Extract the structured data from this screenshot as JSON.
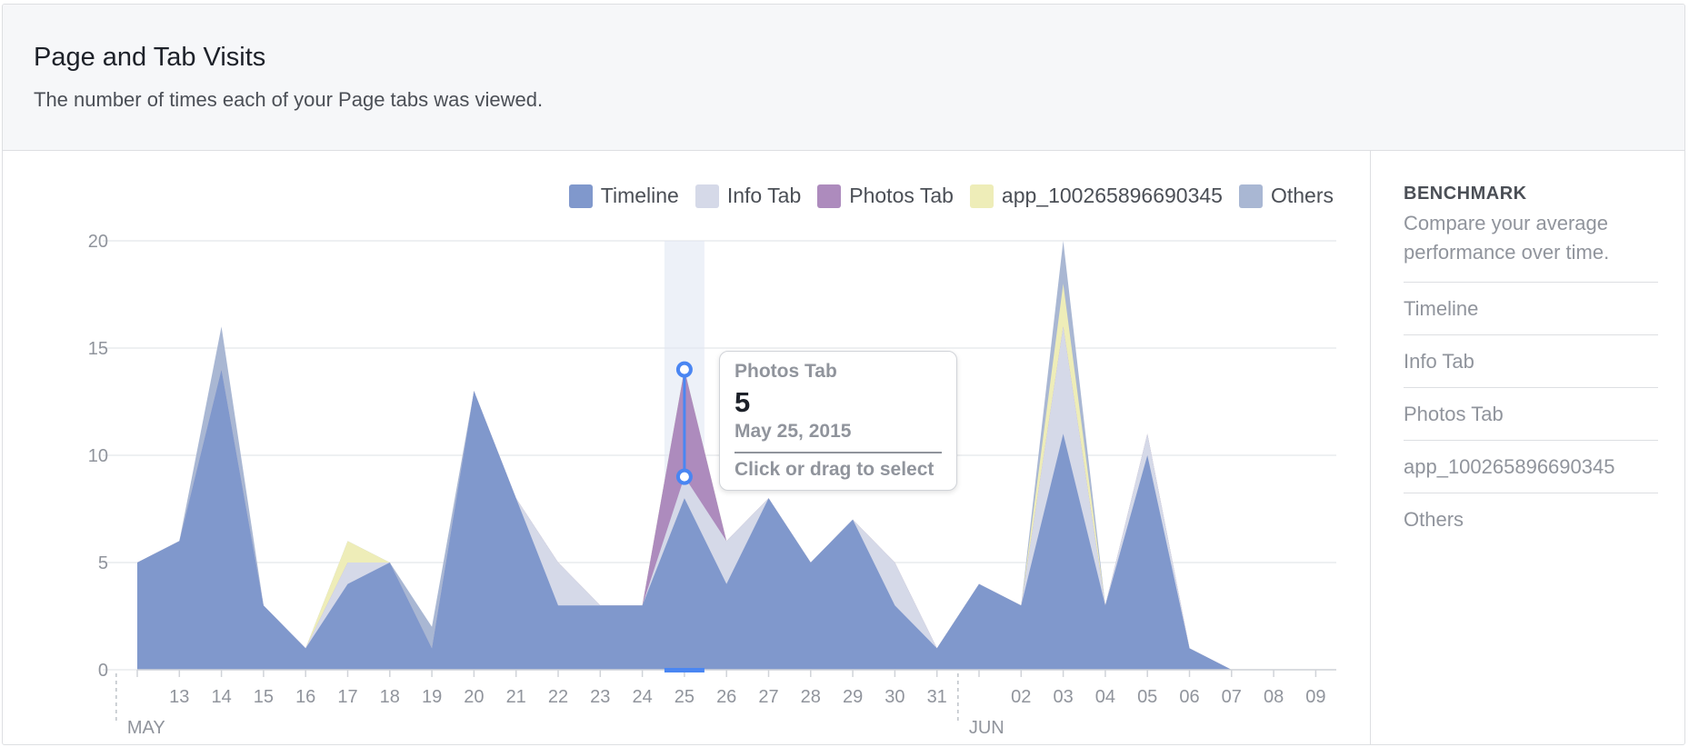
{
  "header": {
    "title": "Page and Tab Visits",
    "subtitle": "The number of times each of your Page tabs was viewed."
  },
  "sidebar": {
    "title": "BENCHMARK",
    "description": "Compare your average performance over time.",
    "items": [
      {
        "label": "Timeline"
      },
      {
        "label": "Info Tab"
      },
      {
        "label": "Photos Tab"
      },
      {
        "label": "app_100265896690345"
      },
      {
        "label": "Others"
      }
    ]
  },
  "tooltip": {
    "series": "Photos Tab",
    "value": "5",
    "date": "May 25, 2015",
    "hint": "Click or drag to select"
  },
  "colors": {
    "timeline": "#8098cc",
    "info_tab": "#d5d9e8",
    "photos_tab": "#ad8bbd",
    "app": "#eeedb8",
    "others": "#a9b7d3",
    "accent": "#4a86f2"
  },
  "chart_data": {
    "type": "area",
    "stacked": true,
    "categories": [
      "12",
      "13",
      "14",
      "15",
      "16",
      "17",
      "18",
      "19",
      "20",
      "21",
      "22",
      "23",
      "24",
      "25",
      "26",
      "27",
      "28",
      "29",
      "30",
      "31",
      "01",
      "02",
      "03",
      "04",
      "05",
      "06",
      "07",
      "08",
      "09"
    ],
    "x_tick_labels": [
      "13",
      "14",
      "15",
      "16",
      "17",
      "18",
      "19",
      "20",
      "21",
      "22",
      "23",
      "24",
      "25",
      "26",
      "27",
      "28",
      "29",
      "30",
      "31",
      "02",
      "03",
      "04",
      "05",
      "06",
      "07",
      "08",
      "09"
    ],
    "month_labels": [
      {
        "label": "MAY",
        "at": "12"
      },
      {
        "label": "JUN",
        "at": "01"
      }
    ],
    "ylim": [
      0,
      20
    ],
    "yticks": [
      0,
      5,
      10,
      15,
      20
    ],
    "grid": true,
    "legend_position": "top-right",
    "series": [
      {
        "name": "Timeline",
        "color": "#8098cc",
        "values": [
          5,
          6,
          14,
          3,
          1,
          4,
          5,
          1,
          13,
          8,
          3,
          3,
          3,
          8,
          4,
          8,
          5,
          7,
          3,
          1,
          4,
          3,
          11,
          3,
          10,
          1,
          0,
          0,
          0
        ]
      },
      {
        "name": "Info Tab",
        "color": "#d5d9e8",
        "values": [
          0,
          0,
          0,
          0,
          0,
          1,
          0,
          0,
          0,
          0,
          2,
          0,
          0,
          1,
          2,
          0,
          0,
          0,
          2,
          0,
          0,
          0,
          5,
          0,
          1,
          0,
          0,
          0,
          0
        ]
      },
      {
        "name": "Photos Tab",
        "color": "#ad8bbd",
        "values": [
          0,
          0,
          0,
          0,
          0,
          0,
          0,
          0,
          0,
          0,
          0,
          0,
          0,
          5,
          0,
          0,
          0,
          0,
          0,
          0,
          0,
          0,
          0,
          0,
          0,
          0,
          0,
          0,
          0
        ]
      },
      {
        "name": "app_100265896690345",
        "color": "#eeedb8",
        "values": [
          0,
          0,
          0,
          0,
          0,
          1,
          0,
          0,
          0,
          0,
          0,
          0,
          0,
          0,
          0,
          0,
          0,
          0,
          0,
          0,
          0,
          0,
          2,
          0,
          0,
          0,
          0,
          0,
          0
        ]
      },
      {
        "name": "Others",
        "color": "#a9b7d3",
        "values": [
          0,
          0,
          2,
          0,
          0,
          0,
          0,
          1,
          0,
          0,
          0,
          0,
          0,
          0,
          0,
          0,
          0,
          0,
          0,
          0,
          0,
          0,
          2,
          0,
          0,
          0,
          0,
          0,
          0
        ]
      }
    ],
    "highlight": {
      "category": "25",
      "series": "Photos Tab",
      "value": 5
    }
  }
}
